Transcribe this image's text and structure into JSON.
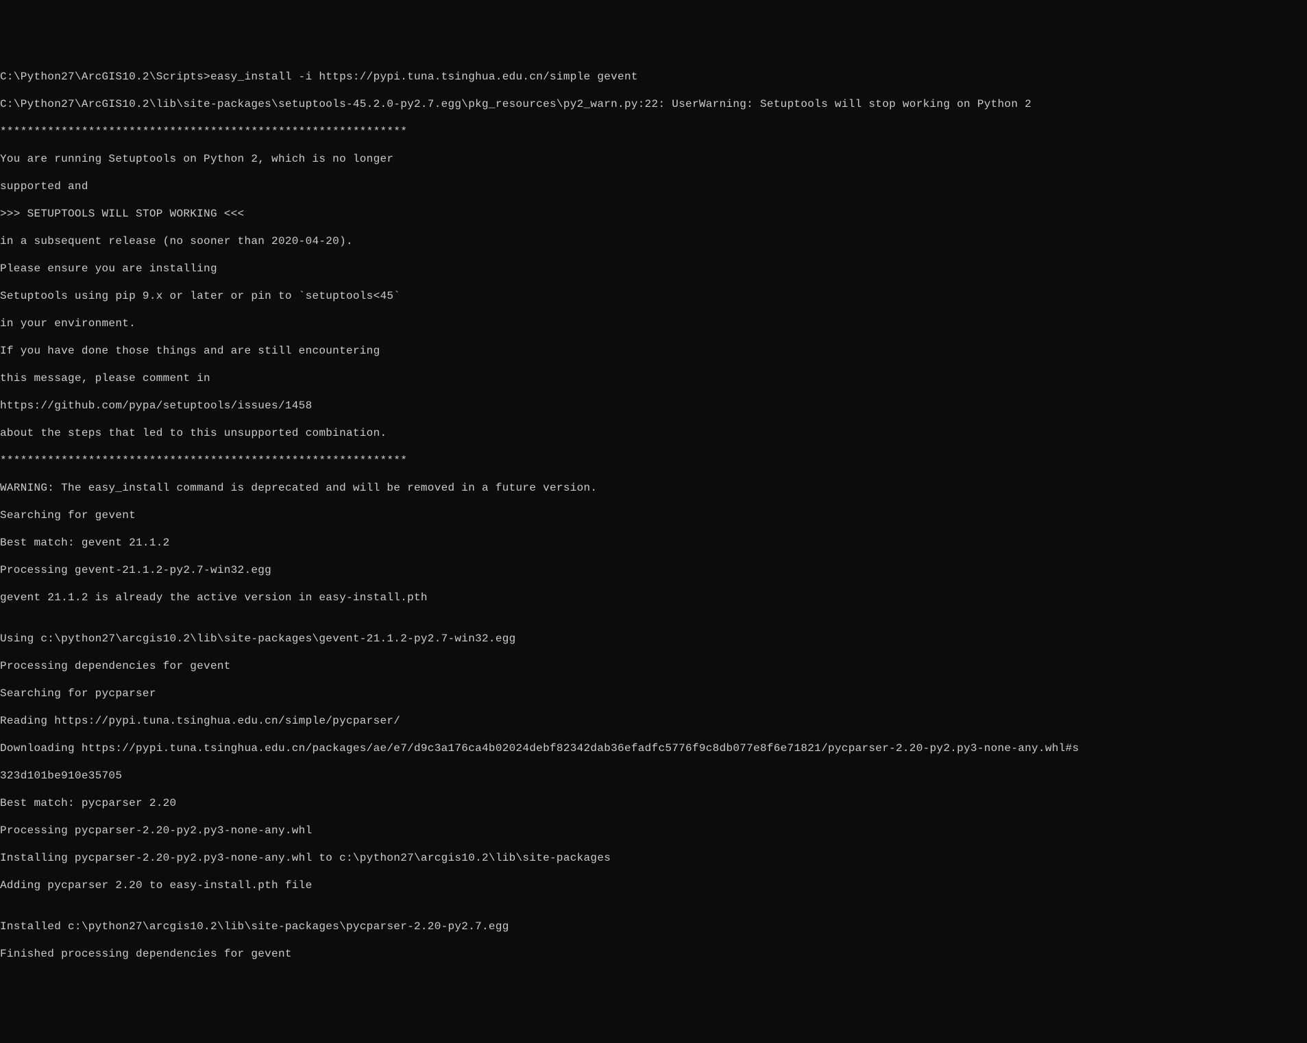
{
  "terminal": {
    "lines": [
      "C:\\Python27\\ArcGIS10.2\\Scripts>easy_install -i https://pypi.tuna.tsinghua.edu.cn/simple gevent",
      "C:\\Python27\\ArcGIS10.2\\lib\\site-packages\\setuptools-45.2.0-py2.7.egg\\pkg_resources\\py2_warn.py:22: UserWarning: Setuptools will stop working on Python 2",
      "************************************************************",
      "You are running Setuptools on Python 2, which is no longer",
      "supported and",
      ">>> SETUPTOOLS WILL STOP WORKING <<<",
      "in a subsequent release (no sooner than 2020-04-20).",
      "Please ensure you are installing",
      "Setuptools using pip 9.x or later or pin to `setuptools<45`",
      "in your environment.",
      "If you have done those things and are still encountering",
      "this message, please comment in",
      "https://github.com/pypa/setuptools/issues/1458",
      "about the steps that led to this unsupported combination.",
      "************************************************************",
      "WARNING: The easy_install command is deprecated and will be removed in a future version.",
      "Searching for gevent",
      "Best match: gevent 21.1.2",
      "Processing gevent-21.1.2-py2.7-win32.egg",
      "gevent 21.1.2 is already the active version in easy-install.pth",
      "",
      "Using c:\\python27\\arcgis10.2\\lib\\site-packages\\gevent-21.1.2-py2.7-win32.egg",
      "Processing dependencies for gevent",
      "Searching for pycparser",
      "Reading https://pypi.tuna.tsinghua.edu.cn/simple/pycparser/",
      "Downloading https://pypi.tuna.tsinghua.edu.cn/packages/ae/e7/d9c3a176ca4b02024debf82342dab36efadfc5776f9c8db077e8f6e71821/pycparser-2.20-py2.py3-none-any.whl#s",
      "323d101be910e35705",
      "Best match: pycparser 2.20",
      "Processing pycparser-2.20-py2.py3-none-any.whl",
      "Installing pycparser-2.20-py2.py3-none-any.whl to c:\\python27\\arcgis10.2\\lib\\site-packages",
      "Adding pycparser 2.20 to easy-install.pth file",
      "",
      "Installed c:\\python27\\arcgis10.2\\lib\\site-packages\\pycparser-2.20-py2.7.egg",
      "Finished processing dependencies for gevent"
    ]
  }
}
